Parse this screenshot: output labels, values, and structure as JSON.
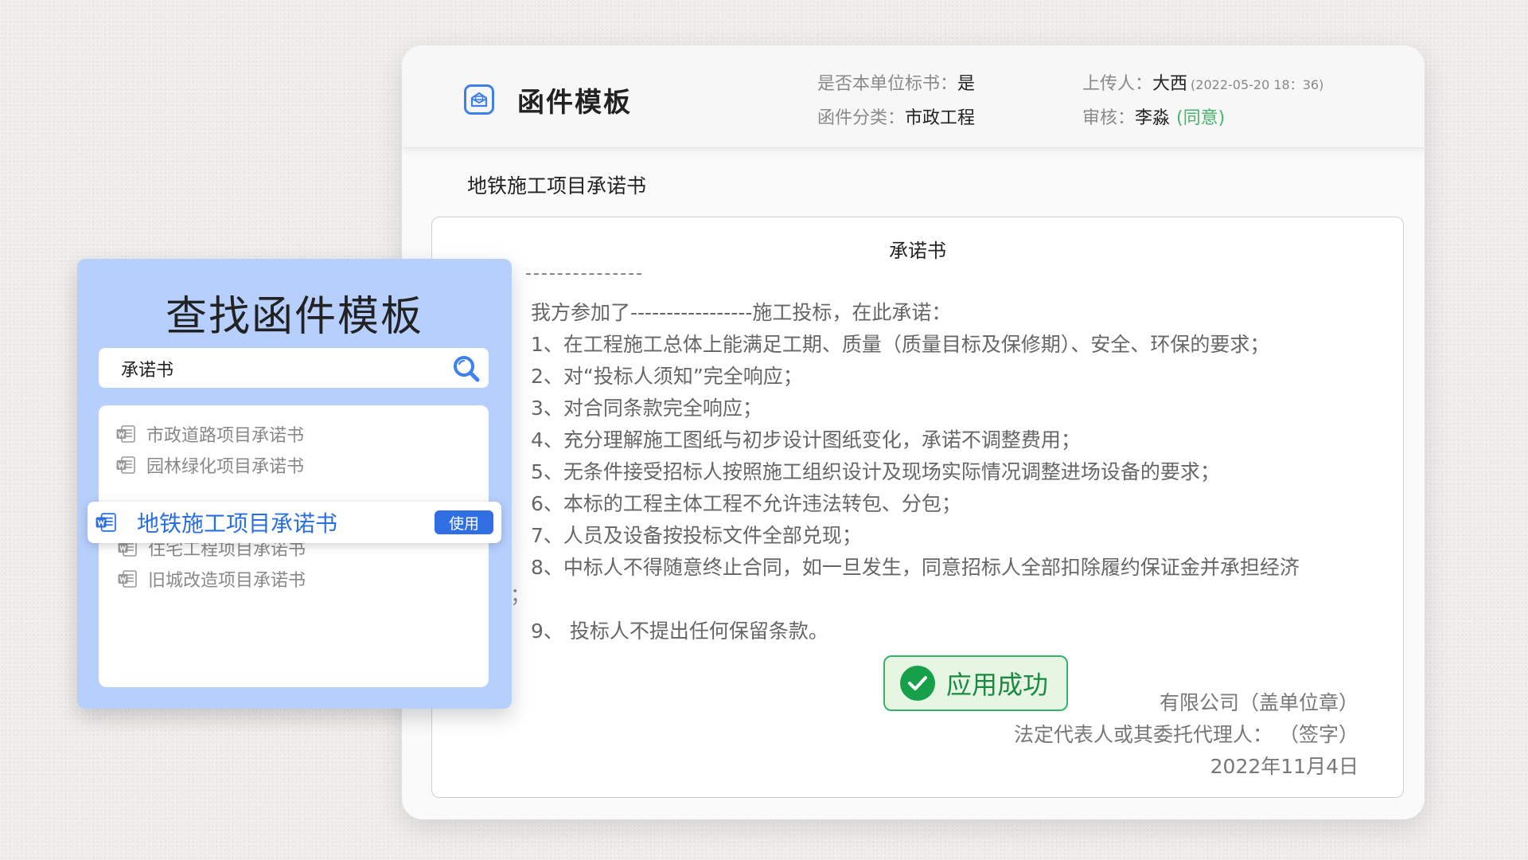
{
  "app": {
    "title": "函件模板"
  },
  "header_meta": {
    "own_unit_label": "是否本单位标书：",
    "own_unit_value": "是",
    "category_label": "函件分类：",
    "category_value": "市政工程",
    "uploader_label": "上传人：",
    "uploader_value": "大西",
    "upload_time": "(2022-05-20  18：36)",
    "reviewer_label": "审核：",
    "reviewer_value": "李淼",
    "review_status": "(同意)"
  },
  "document": {
    "title": "地铁施工项目承诺书",
    "heading": "承诺书",
    "dashes": "---------------",
    "intro": "我方参加了-----------------施工投标，在此承诺：",
    "clauses": [
      "1、在工程施工总体上能满足工期、质量（质量目标及保修期）、安全、环保的要求；",
      "2、对“投标人须知”完全响应；",
      "3、对合同条款完全响应；",
      "4、充分理解施工图纸与初步设计图纸变化，承诺不调整费用；",
      "5、无条件接受招标人按照施工组织设计及现场实际情况调整进场设备的要求；",
      "6、本标的工程主体工程不允许违法转包、分包；",
      "7、人员及设备按投标文件全部兑现；",
      "8、中标人不得随意终止合同，如一旦发生，同意招标人全部扣除履约保证金并承担经济",
      "9、 投标人不提出任何保留条款。"
    ],
    "overflow_fragment": "；",
    "signature": {
      "company": "有限公司（盖单位章）",
      "representative": "法定代表人或其委托代理人：           （签字）",
      "date": "2022年11月4日"
    }
  },
  "success_badge": {
    "text": "应用成功"
  },
  "search_panel": {
    "title": "查找函件模板",
    "search_value": "承诺书",
    "results": [
      {
        "label": "市政道路项目承诺书",
        "selected": false
      },
      {
        "label": "园林绿化项目承诺书",
        "selected": false
      },
      {
        "label": "地铁施工项目承诺书",
        "selected": true
      },
      {
        "label": "住宅工程项目承诺书",
        "selected": false
      },
      {
        "label": "旧城改造项目承诺书",
        "selected": false
      }
    ],
    "use_button_label": "使用"
  },
  "colors": {
    "accent_blue": "#2f6fe3",
    "panel_blue": "#b7cffd",
    "success_green": "#16a04a",
    "approve_green": "#46b36a"
  },
  "icons": {
    "app": "mail-template-icon",
    "search": "search-icon",
    "result": "word-doc-icon",
    "success": "check-circle-icon"
  }
}
